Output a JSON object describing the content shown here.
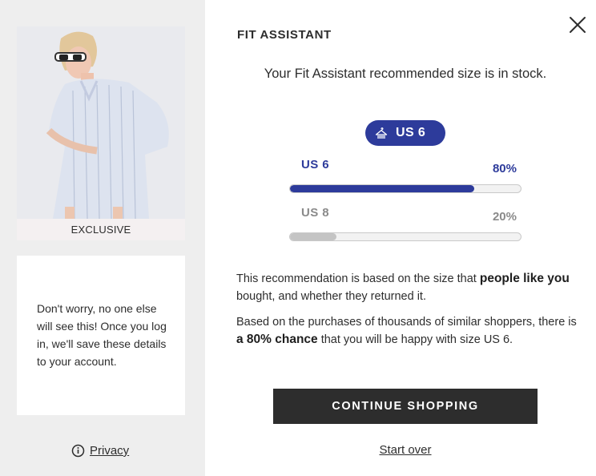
{
  "left_panel": {
    "product_badge": "EXCLUSIVE",
    "info_text": "Don't worry, no one else will see this! Once you log in, we'll save these details to your account.",
    "privacy_label": "Privacy",
    "privacy_icon": "info-icon"
  },
  "header": {
    "title": "FIT ASSISTANT",
    "close_icon": "close-icon"
  },
  "recommendation": {
    "message": "Your Fit Assistant recommended size is in stock.",
    "recommended_size": "US 6",
    "pill_icon": "hanger-icon",
    "sizes": [
      {
        "label": "US 6",
        "percent_text": "80%",
        "fraction": 0.8,
        "color": "#2d3b9b",
        "label_color": "#2d3b9b"
      },
      {
        "label": "US 8",
        "percent_text": "20%",
        "fraction": 0.2,
        "color": "#c4c4c4",
        "label_color": "#8a8a8a"
      }
    ]
  },
  "explanation": {
    "p1_start": "This recommendation is based on the size that ",
    "p1_bold": "people like you",
    "p1_end": " bought, and whether they returned it.",
    "p2_start": "Based on the purchases of thousands of similar shoppers, there is ",
    "p2_bold": "a 80% chance",
    "p2_end": " that you will be happy with size US 6."
  },
  "actions": {
    "continue_label": "CONTINUE SHOPPING",
    "start_over_label": "Start over"
  },
  "colors": {
    "accent": "#2d3b9b",
    "button_bg": "#2d2d2d",
    "panel_bg": "#eeeeee"
  }
}
